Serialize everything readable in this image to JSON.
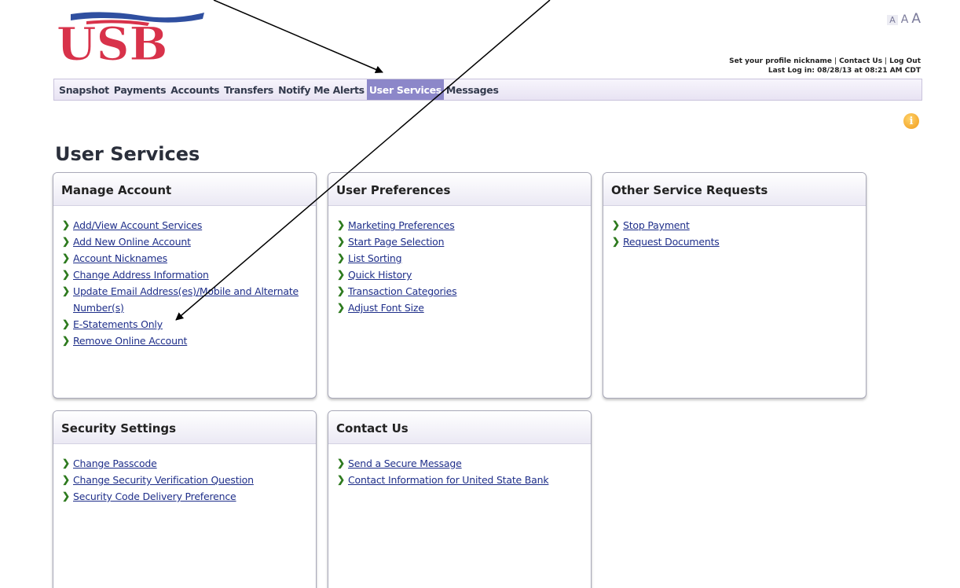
{
  "font_size_control": [
    "A",
    "A",
    "A"
  ],
  "header": {
    "logo_text": "USB",
    "links": [
      "Set your profile nickname",
      "Contact Us",
      "Log Out"
    ],
    "last_login": "Last Log in: 08/28/13 at 08:21 AM CDT"
  },
  "nav": {
    "items": [
      "Snapshot",
      "Payments",
      "Accounts",
      "Transfers",
      "Notify Me Alerts",
      "User Services",
      "Messages"
    ],
    "active": "User Services"
  },
  "page_title": "User Services",
  "panels": [
    {
      "title": "Manage Account",
      "links": [
        "Add/View Account Services",
        "Add New Online Account",
        "Account Nicknames",
        "Change Address Information",
        "Update Email Address(es)/Mobile and Alternate Number(s)",
        "E-Statements Only",
        "Remove Online Account"
      ]
    },
    {
      "title": "User Preferences",
      "links": [
        "Marketing Preferences",
        "Start Page Selection",
        "List Sorting",
        "Quick History",
        "Transaction Categories",
        "Adjust Font Size"
      ]
    },
    {
      "title": "Other Service Requests",
      "links": [
        "Stop Payment",
        "Request Documents"
      ]
    },
    {
      "title": "Security Settings",
      "links": [
        "Change Passcode",
        "Change Security Verification Question",
        "Security Code Delivery Preference"
      ]
    },
    {
      "title": "Contact Us",
      "links": [
        "Send a Secure Message",
        "Contact Information for United State Bank"
      ]
    }
  ],
  "icons": {
    "info": "info-icon",
    "link_bullet": "chevron-right-icon"
  },
  "colors": {
    "nav_active_bg": "#8c87c9",
    "link": "#1f2f8a",
    "chevron": "#2d7a1e",
    "logo_red": "#d8324a",
    "logo_blue": "#2f4fa0"
  }
}
